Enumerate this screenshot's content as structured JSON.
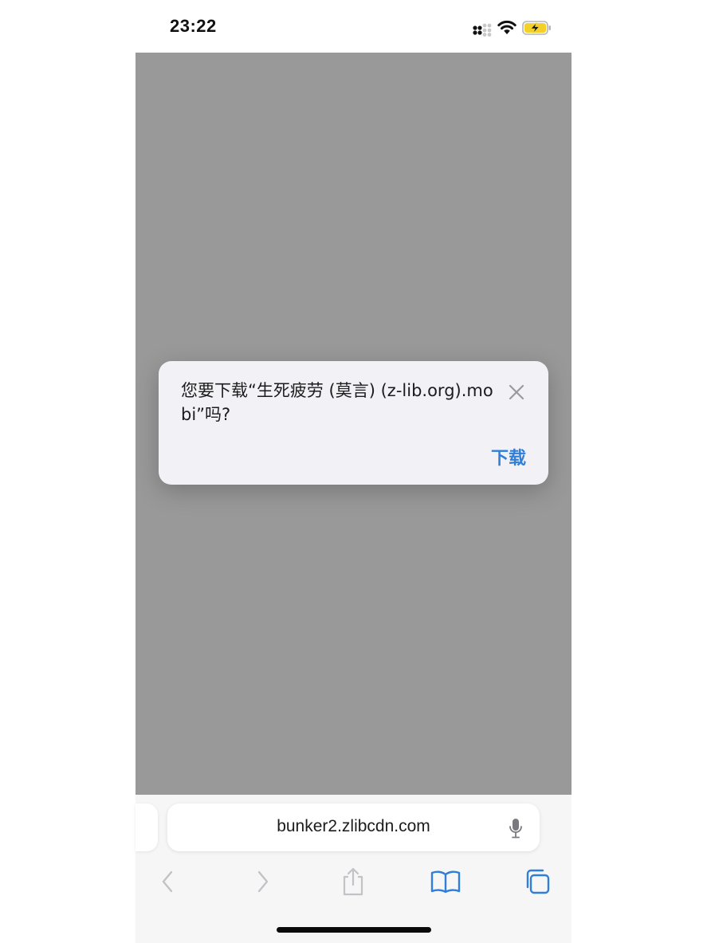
{
  "status_bar": {
    "time": "23:22",
    "signal_icon": "cellular-signal-icon",
    "wifi_icon": "wifi-icon",
    "battery_icon": "battery-charging-icon",
    "battery_color": "#f5d029"
  },
  "dialog": {
    "message": "您要下载“生死疲劳 (莫言) (z-lib.org).mobi”吗?",
    "close_icon": "close-icon",
    "action_label": "下载",
    "action_color": "#2f7fd8"
  },
  "browser": {
    "address": "bunker2.zlibcdn.com",
    "mic_icon": "microphone-icon",
    "toolbar": {
      "back_icon": "chevron-left-icon",
      "forward_icon": "chevron-right-icon",
      "share_icon": "share-icon",
      "bookmarks_icon": "book-icon",
      "tabs_icon": "tabs-icon",
      "accent_color": "#2f7fd8"
    }
  }
}
